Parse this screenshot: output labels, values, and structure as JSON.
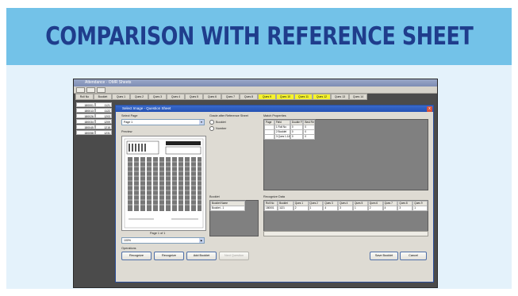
{
  "slide": {
    "title": "COMPARISON WITH REFERENCE SHEET",
    "colors": {
      "banner": "#73c2e8",
      "title": "#1f3d8c",
      "panel": "#e4f2fb"
    }
  },
  "app": {
    "title": "Attendance · OMR Sheets",
    "toolbar": [
      "",
      "",
      ""
    ],
    "sheet_headers": [
      "Roll No",
      "Booklet",
      "Ques 1",
      "Ques 2",
      "Ques 3",
      "Ques 4",
      "Ques 5",
      "Ques 6",
      "Ques 7",
      "Ques 8",
      "Ques 9",
      "Ques 10",
      "Ques 11",
      "Ques 12",
      "Ques 13",
      "Ques 14"
    ],
    "sheet_rows": [
      [
        "180001",
        "1121"
      ],
      [
        "180013",
        "1122"
      ],
      [
        "180026",
        "1203"
      ],
      [
        "180034",
        "1209"
      ],
      [
        "180045",
        "1215"
      ],
      [
        "180058",
        "1231"
      ]
    ]
  },
  "dialog": {
    "title": "Select Image - Question Sheet",
    "close_label": "x",
    "select_page_label": "Select Page",
    "page_value": "Page 1",
    "preview_label": "Preview",
    "page_indicator": "Page 1 of 1",
    "zoom_value": "100%",
    "options_label": "Operations",
    "ref_label": "Grade after Reference Sheet",
    "radio_a": "Booklet",
    "radio_b": "Number",
    "answer_key_label": "Match Properties",
    "answer_head": [
      "Page",
      "Field",
      "Double Field",
      "Best Field"
    ],
    "answer_rows": [
      [
        "",
        "1 Roll No",
        "0",
        "0"
      ],
      [
        "",
        "2 Booklet",
        "0",
        "0"
      ],
      [
        "",
        "3 Ques 1-14",
        "0",
        "0"
      ]
    ],
    "booklet_label": "Booklet",
    "booklet_head": "Booklet Name",
    "booklet_value": "Booklet - 1",
    "results_label": "Recognize Data",
    "results_head": [
      "Roll No",
      "Booklet",
      "Ques 1",
      "Ques 2",
      "Ques 3",
      "Ques 4",
      "Ques 5",
      "Ques 6",
      "Ques 7",
      "Ques 8",
      "Ques 9"
    ],
    "results_row": [
      "180001",
      "1121",
      "2",
      "1",
      "4",
      "3",
      "1",
      "2",
      "4",
      "3",
      "1"
    ],
    "buttons": {
      "recognize": "Recognize",
      "recognize_all": "Recognize",
      "add_booklet": "Add Booklet",
      "next_question": "Next Question",
      "save_booklet": "Save Booklet",
      "cancel": "Cancel"
    }
  }
}
